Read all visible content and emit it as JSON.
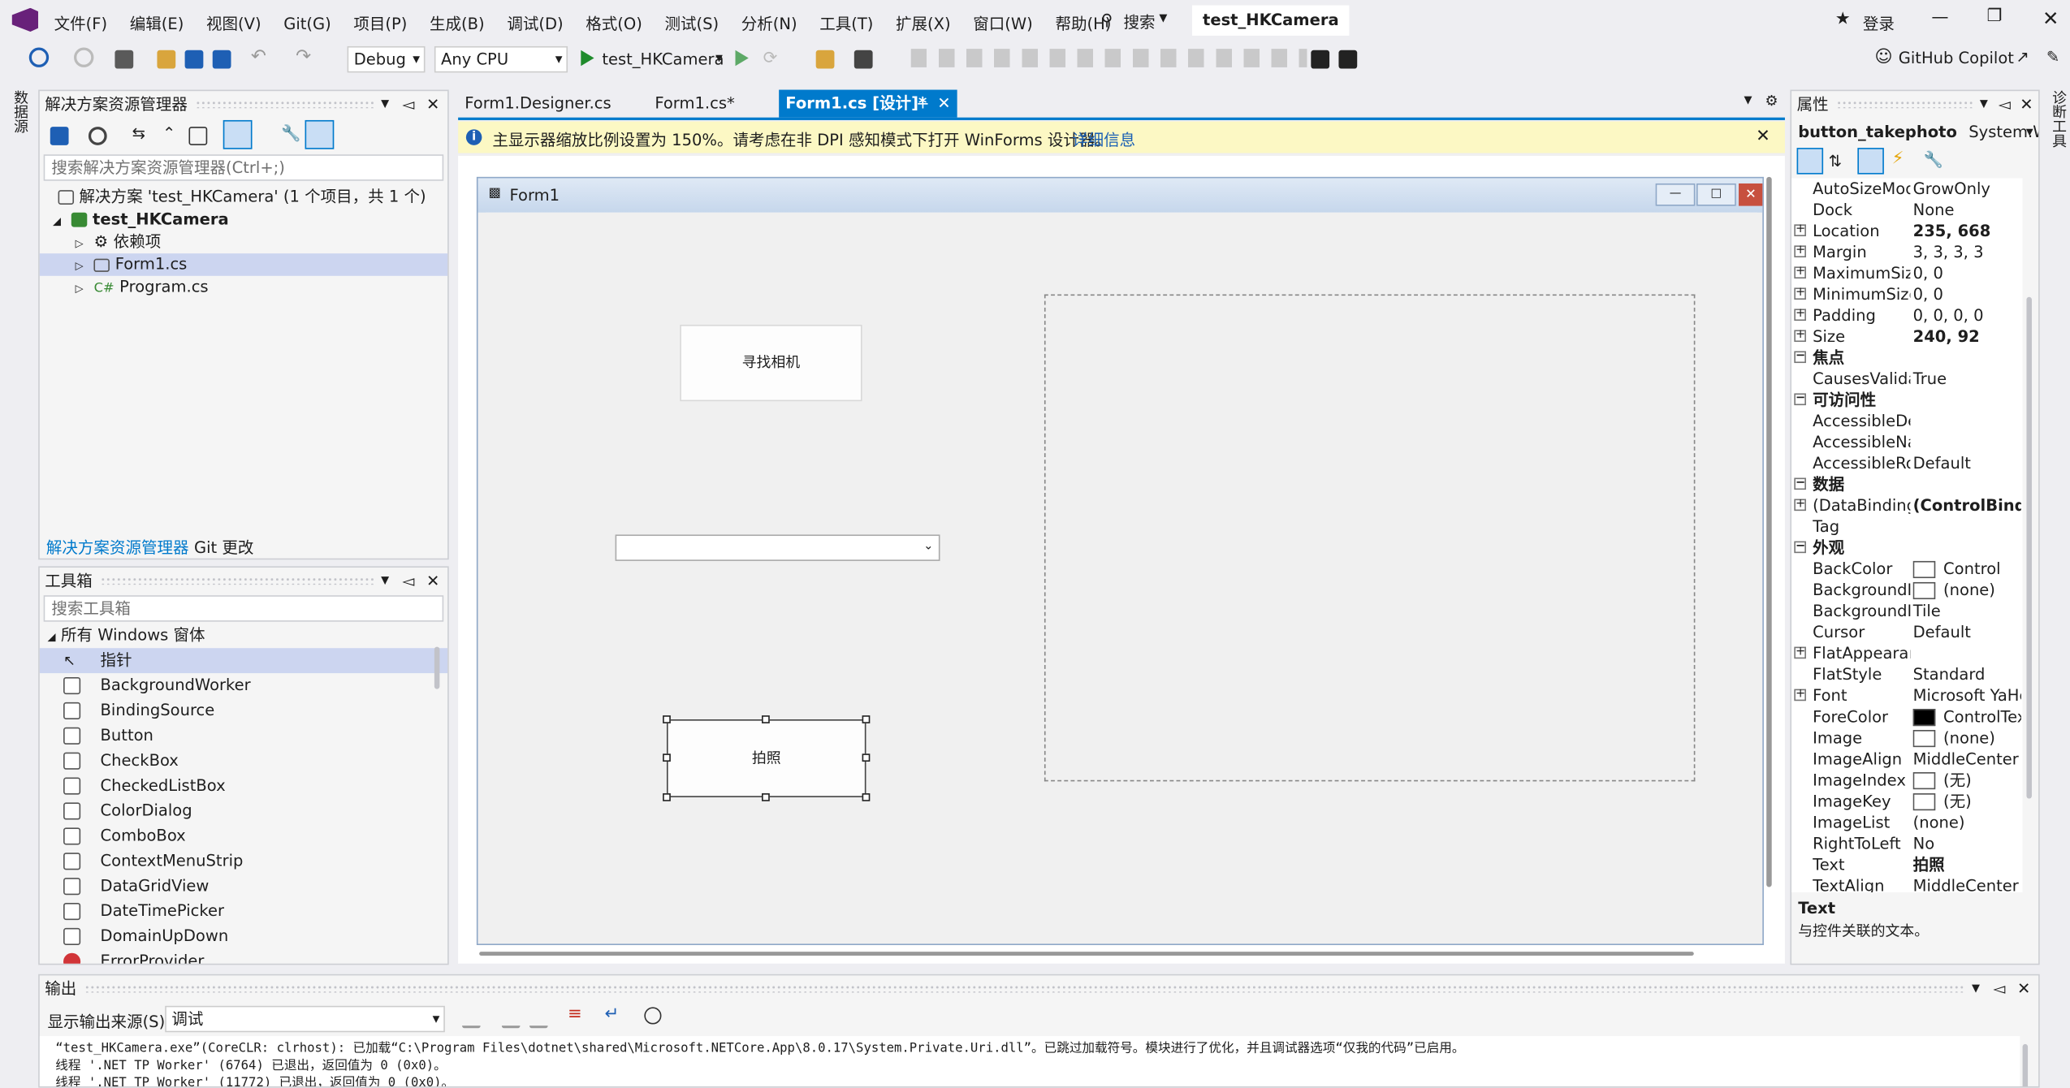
{
  "menu": [
    "文件(F)",
    "编辑(E)",
    "视图(V)",
    "Git(G)",
    "项目(P)",
    "生成(B)",
    "调试(D)",
    "格式(O)",
    "测试(S)",
    "分析(N)",
    "工具(T)",
    "扩展(X)",
    "窗口(W)",
    "帮助(H)"
  ],
  "search_label": "搜索",
  "solution_badge": "test_HKCamera",
  "login": "登录",
  "toolbar": {
    "config": "Debug",
    "platform": "Any CPU",
    "run_target": "test_HKCamera",
    "copilot": "GitHub Copilot"
  },
  "left_strip": "数据源",
  "right_strip": "诊断工具",
  "solution_explorer": {
    "title": "解决方案资源管理器",
    "search_placeholder": "搜索解决方案资源管理器(Ctrl+;)",
    "items": [
      "解决方案 'test_HKCamera' (1 个项目，共 1 个)",
      "test_HKCamera",
      "依赖项",
      "Form1.cs",
      "Program.cs"
    ],
    "tabs": [
      "解决方案资源管理器",
      "Git 更改"
    ]
  },
  "toolbox": {
    "title": "工具箱",
    "search_placeholder": "搜索工具箱",
    "group": "所有 Windows 窗体",
    "items": [
      "指针",
      "BackgroundWorker",
      "BindingSource",
      "Button",
      "CheckBox",
      "CheckedListBox",
      "ColorDialog",
      "ComboBox",
      "ContextMenuStrip",
      "DataGridView",
      "DateTimePicker",
      "DomainUpDown",
      "ErrorProvider"
    ]
  },
  "doc_tabs": [
    "Form1.Designer.cs",
    "Form1.cs*",
    "Form1.cs [设计]*"
  ],
  "infobar": {
    "message": "主显示器缩放比例设置为 150%。请考虑在非 DPI 感知模式下打开 WinForms 设计器。",
    "link": "详细信息"
  },
  "form": {
    "title": "Form1",
    "btn_find": "寻找相机",
    "btn_photo": "拍照"
  },
  "properties": {
    "title": "属性",
    "object": "button_takephoto",
    "object_type": "System.Wi",
    "rows": [
      {
        "k": "AutoSizeMode",
        "v": "GrowOnly"
      },
      {
        "k": "Dock",
        "v": "None"
      },
      {
        "k": "Location",
        "v": "235, 668",
        "plus": true,
        "bold": true
      },
      {
        "k": "Margin",
        "v": "3, 3, 3, 3",
        "plus": true
      },
      {
        "k": "MaximumSize",
        "v": "0, 0",
        "plus": true
      },
      {
        "k": "MinimumSize",
        "v": "0, 0",
        "plus": true
      },
      {
        "k": "Padding",
        "v": "0, 0, 0, 0",
        "plus": true
      },
      {
        "k": "Size",
        "v": "240, 92",
        "plus": true,
        "bold": true
      },
      {
        "k": "焦点",
        "cat": true
      },
      {
        "k": "CausesValidation",
        "v": "True"
      },
      {
        "k": "可访问性",
        "cat": true
      },
      {
        "k": "AccessibleDescription",
        "v": ""
      },
      {
        "k": "AccessibleName",
        "v": ""
      },
      {
        "k": "AccessibleRole",
        "v": "Default"
      },
      {
        "k": "数据",
        "cat": true
      },
      {
        "k": "(DataBindings)",
        "v": "(ControlBindings)",
        "plus": true,
        "bold": true
      },
      {
        "k": "Tag",
        "v": ""
      },
      {
        "k": "外观",
        "cat": true
      },
      {
        "k": "BackColor",
        "v": "Control",
        "swatch": "#ffffff"
      },
      {
        "k": "BackgroundImage",
        "v": "(none)",
        "swatch": "#ffffff"
      },
      {
        "k": "BackgroundImageLayout",
        "v": "Tile"
      },
      {
        "k": "Cursor",
        "v": "Default"
      },
      {
        "k": "FlatAppearance",
        "v": "",
        "plus": true
      },
      {
        "k": "FlatStyle",
        "v": "Standard"
      },
      {
        "k": "Font",
        "v": "Microsoft YaHei",
        "plus": true
      },
      {
        "k": "ForeColor",
        "v": "ControlText",
        "swatch": "#000000"
      },
      {
        "k": "Image",
        "v": "(none)",
        "swatch": "#ffffff"
      },
      {
        "k": "ImageAlign",
        "v": "MiddleCenter"
      },
      {
        "k": "ImageIndex",
        "v": "(无)",
        "swatch": "#ffffff"
      },
      {
        "k": "ImageKey",
        "v": "(无)",
        "swatch": "#ffffff"
      },
      {
        "k": "ImageList",
        "v": "(none)"
      },
      {
        "k": "RightToLeft",
        "v": "No"
      },
      {
        "k": "Text",
        "v": "拍照",
        "bold": true
      },
      {
        "k": "TextAlign",
        "v": "MiddleCenter"
      }
    ],
    "desc_title": "Text",
    "desc_text": "与控件关联的文本。"
  },
  "output": {
    "title": "输出",
    "source_label": "显示输出来源(S):",
    "source_value": "调试",
    "lines": [
      "“test_HKCamera.exe”(CoreCLR: clrhost): 已加载“C:\\Program Files\\dotnet\\shared\\Microsoft.NETCore.App\\8.0.17\\System.Private.Uri.dll”。已跳过加载符号。模块进行了优化，并且调试器选项“仅我的代码”已启用。",
      "线程 '.NET TP Worker' (6764) 已退出，返回值为 0 (0x0)。",
      "线程 '.NET TP Worker' (11772) 已退出，返回值为 0 (0x0)。"
    ]
  },
  "colors": {
    "accent": "#007acc",
    "infobar": "#fcf8c4",
    "active_tab": "#007acc"
  }
}
